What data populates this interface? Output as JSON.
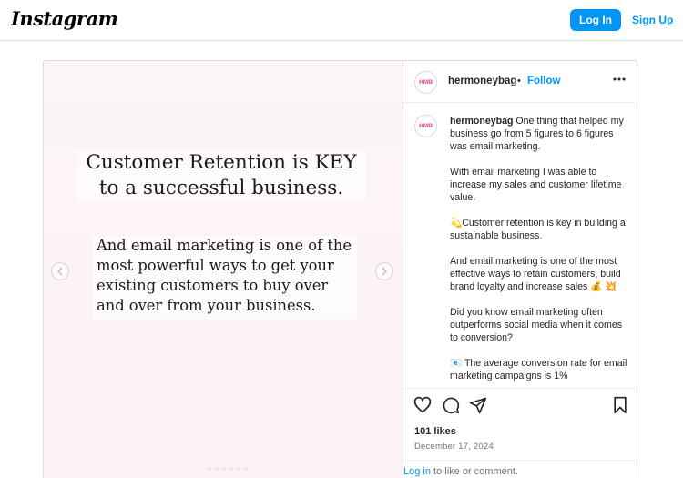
{
  "topbar": {
    "logo": "Instagram",
    "login_label": "Log In",
    "signup_label": "Sign Up"
  },
  "media": {
    "slide_line1": "Customer Retention is KEY",
    "slide_line2": "to a successful business.",
    "slide_para": [
      "And email marketing is one of the",
      "most powerful ways to get your",
      "existing customers to buy over",
      "and over from your business."
    ],
    "prev_icon": "chevron-left-icon",
    "next_icon": "chevron-right-icon"
  },
  "post": {
    "avatar_text": "HMB",
    "username": "hermoneybag",
    "separator": "•",
    "follow_label": "Follow",
    "more_icon": "more-horizontal-icon",
    "caption_user": "hermoneybag",
    "caption_first": "One thing that helped my business go from 5 figures to 6 figures was email marketing.",
    "caption_paragraphs": [
      "With email marketing I was able to increase my sales and customer lifetime value.",
      "💫Customer retention is key in building a sustainable business.",
      "And email marketing is one of the most effective ways to retain customers, build brand loyalty and increase sales 💰 💥",
      "Did you know email marketing often outperforms social media when it comes to conversion?",
      "📧 The average conversion rate for email marketing campaigns is 1%"
    ],
    "likes": "101 likes",
    "date": "December 17, 2024",
    "login_link": "Log in",
    "login_suffix": " to like or comment.",
    "action_icons": [
      "heart-icon",
      "comment-icon",
      "share-icon",
      "bookmark-icon"
    ]
  },
  "colors": {
    "accent": "#0095f6",
    "border": "#dbdbdb",
    "text": "#262626",
    "muted": "#737373"
  }
}
